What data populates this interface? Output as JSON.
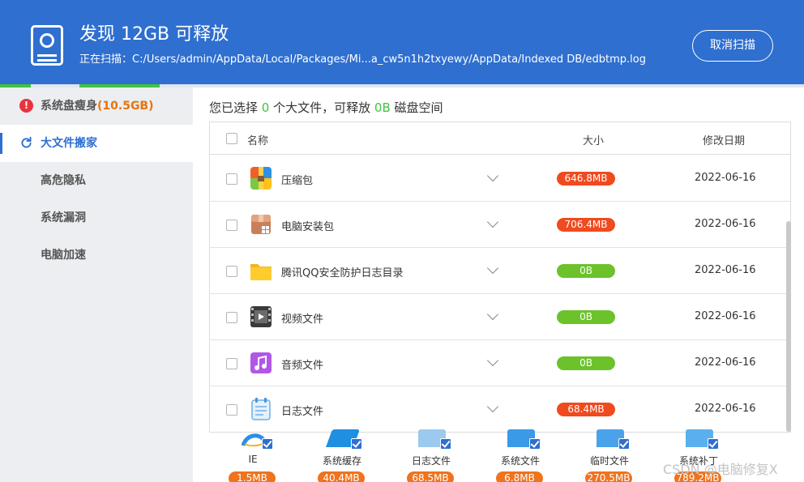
{
  "header": {
    "title": "发现 12GB 可释放",
    "scan_path": "正在扫描：C:/Users/admin/AppData/Local/Packages/Mi...a_cw5n1h2txyewy/AppData/Indexed DB/edbtmp.log",
    "cancel_label": "取消扫描"
  },
  "sidebar": {
    "items": [
      {
        "label": "系统盘瘦身",
        "badge": "(10.5GB)"
      },
      {
        "label": "大文件搬家"
      },
      {
        "label": "高危隐私"
      },
      {
        "label": "系统漏洞"
      },
      {
        "label": "电脑加速"
      }
    ]
  },
  "summary": {
    "prefix": "您已选择",
    "count": "0",
    "mid": "个大文件，可释放",
    "size": "0B",
    "suffix": "磁盘空间"
  },
  "table": {
    "headers": {
      "name": "名称",
      "size": "大小",
      "date": "修改日期"
    },
    "rows": [
      {
        "name": "压缩包",
        "size": "646.8MB",
        "date": "2022-06-16",
        "icon": "archive-icon",
        "size_color": "#f04a1f"
      },
      {
        "name": "电脑安装包",
        "size": "706.4MB",
        "date": "2022-06-16",
        "icon": "installer-icon",
        "size_color": "#f04a1f"
      },
      {
        "name": "腾讯QQ安全防护日志目录",
        "size": "0B",
        "date": "2022-06-16",
        "icon": "folder-icon",
        "size_color": "#6bc22b"
      },
      {
        "name": "视频文件",
        "size": "0B",
        "date": "2022-06-16",
        "icon": "video-icon",
        "size_color": "#6bc22b"
      },
      {
        "name": "音频文件",
        "size": "0B",
        "date": "2022-06-16",
        "icon": "music-icon",
        "size_color": "#6bc22b"
      },
      {
        "name": "日志文件",
        "size": "68.4MB",
        "date": "2022-06-16",
        "icon": "log-icon",
        "size_color": "#f04a1f"
      }
    ]
  },
  "categories": [
    {
      "label": "IE",
      "size": "1.5MB",
      "icon": "ie-icon"
    },
    {
      "label": "系统缓存",
      "size": "40.4MB",
      "icon": "cache-icon"
    },
    {
      "label": "日志文件",
      "size": "68.5MB",
      "icon": "log-file-icon"
    },
    {
      "label": "系统文件",
      "size": "6.8MB",
      "icon": "windows-icon"
    },
    {
      "label": "临时文件",
      "size": "270.5MB",
      "icon": "temp-file-icon"
    },
    {
      "label": "系统补丁",
      "size": "789.2MB",
      "icon": "patch-icon"
    }
  ],
  "watermark": "CSDN @电脑修复X",
  "colors": {
    "brand": "#2e6fd0",
    "green": "#41c241",
    "orange": "#f0731d"
  }
}
